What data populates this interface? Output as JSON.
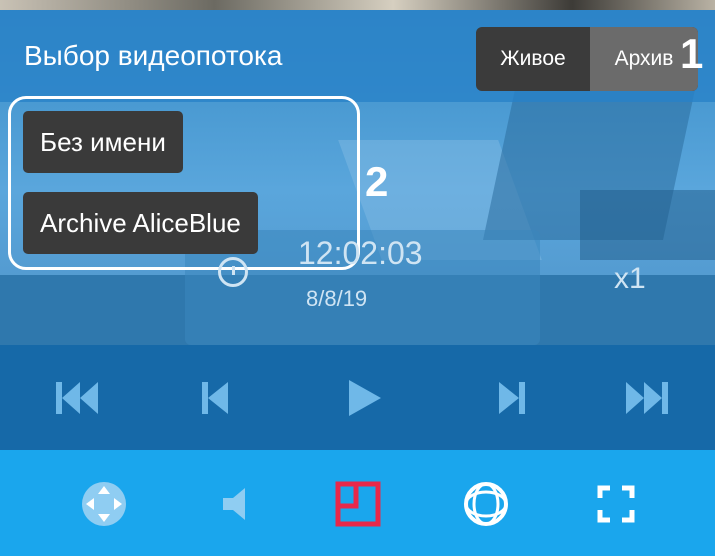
{
  "header": {
    "title": "Выбор видеопотока",
    "mode": {
      "live_label": "Живое",
      "archive_label": "Архив",
      "selected": "Архив"
    }
  },
  "callouts": {
    "one": "1",
    "two": "2"
  },
  "streams": [
    {
      "label": "Без имени"
    },
    {
      "label": "Archive AliceBlue"
    }
  ],
  "playback": {
    "time": "12:02:03",
    "date": "8/8/19",
    "speed": "x1"
  },
  "icons": {
    "controls": [
      "skip-to-start-icon",
      "step-back-icon",
      "play-icon",
      "step-forward-icon",
      "skip-to-end-icon"
    ],
    "toolbar": [
      "ptz-control-icon",
      "audio-icon",
      "layout-icon",
      "fisheye-icon",
      "fullscreen-icon"
    ]
  },
  "colors": {
    "accent": "#1aa6ed",
    "control_bar": "#1669a8",
    "active_icon": "#e8284a"
  }
}
